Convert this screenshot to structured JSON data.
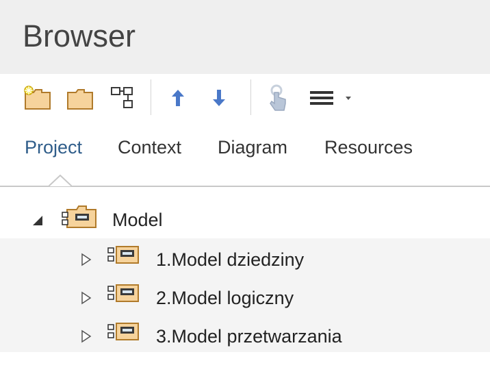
{
  "panel": {
    "title": "Browser"
  },
  "toolbar": {
    "buttons": [
      {
        "name": "new-package-icon"
      },
      {
        "name": "folder-icon"
      },
      {
        "name": "structure-icon"
      },
      {
        "name": "move-up-icon"
      },
      {
        "name": "move-down-icon"
      },
      {
        "name": "locate-icon"
      },
      {
        "name": "menu-icon"
      }
    ]
  },
  "tabs": [
    {
      "label": "Project",
      "active": true
    },
    {
      "label": "Context",
      "active": false
    },
    {
      "label": "Diagram",
      "active": false
    },
    {
      "label": "Resources",
      "active": false
    }
  ],
  "tree": {
    "root": {
      "label": "Model",
      "expanded": true
    },
    "children": [
      {
        "label": "1.Model dziedziny",
        "expanded": false
      },
      {
        "label": "2.Model logiczny",
        "expanded": false
      },
      {
        "label": "3.Model przetwarzania",
        "expanded": false
      }
    ]
  },
  "colors": {
    "title_bg": "#efefef",
    "accent": "#2f5d8a",
    "arrow_blue": "#4a78c8",
    "folder_fill": "#f6d39c",
    "folder_stroke": "#b07a2a"
  }
}
